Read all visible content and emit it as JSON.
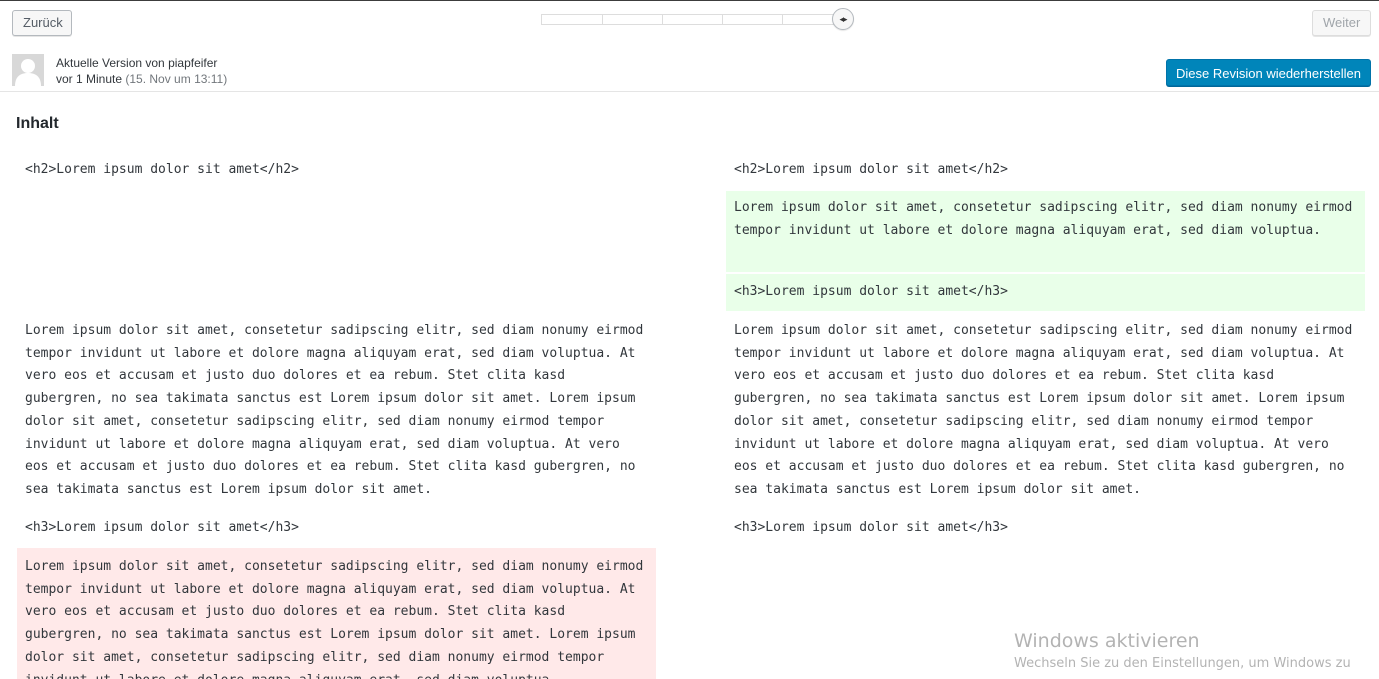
{
  "toolbar": {
    "back_label": "Zurück",
    "next_label": "Weiter",
    "slider_handle_glyph": "◂▸",
    "slider_position": 1.0
  },
  "revision": {
    "title": "Aktuelle Version von piapfeifer",
    "relative_time": "vor 1 Minute",
    "date": "(15. Nov um 13:11)",
    "restore_label": "Diese Revision wiederherstellen"
  },
  "section": {
    "title": "Inhalt"
  },
  "left": {
    "h2": "<h2>Lorem ipsum dolor sit amet</h2>",
    "para": "Lorem ipsum dolor sit amet, consetetur sadipscing elitr, sed diam nonumy eirmod tempor invidunt ut labore et dolore magna aliquyam erat, sed diam voluptua. At vero eos et accusam et justo duo dolores et ea rebum. Stet clita kasd gubergren, no sea takimata sanctus est Lorem ipsum dolor sit amet. Lorem ipsum dolor sit amet, consetetur sadipscing elitr, sed diam nonumy eirmod tempor invidunt ut labore et dolore magna aliquyam erat, sed diam voluptua. At vero eos et accusam et justo duo dolores et ea rebum. Stet clita kasd gubergren, no sea takimata sanctus est Lorem ipsum dolor sit amet.",
    "h3": "<h3>Lorem ipsum dolor sit amet</h3>",
    "removed_para": "Lorem ipsum dolor sit amet, consetetur sadipscing elitr, sed diam nonumy eirmod tempor invidunt ut labore et dolore magna aliquyam erat, sed diam voluptua. At vero eos et accusam et justo duo dolores et ea rebum. Stet clita kasd gubergren, no sea takimata sanctus est Lorem ipsum dolor sit amet. Lorem ipsum dolor sit amet, consetetur sadipscing elitr, sed diam nonumy eirmod tempor invidunt ut labore et dolore magna aliquyam erat, sed diam voluptua."
  },
  "right": {
    "h2": "<h2>Lorem ipsum dolor sit amet</h2>",
    "added_para": "Lorem ipsum dolor sit amet, consetetur sadipscing elitr, sed diam nonumy eirmod tempor invidunt ut labore et dolore magna aliquyam erat, sed diam voluptua.",
    "added_h3": "<h3>Lorem ipsum dolor sit amet</h3>",
    "para": "Lorem ipsum dolor sit amet, consetetur sadipscing elitr, sed diam nonumy eirmod tempor invidunt ut labore et dolore magna aliquyam erat, sed diam voluptua. At vero eos et accusam et justo duo dolores et ea rebum. Stet clita kasd gubergren, no sea takimata sanctus est Lorem ipsum dolor sit amet. Lorem ipsum dolor sit amet, consetetur sadipscing elitr, sed diam nonumy eirmod tempor invidunt ut labore et dolore magna aliquyam erat, sed diam voluptua. At vero eos et accusam et justo duo dolores et ea rebum. Stet clita kasd gubergren, no sea takimata sanctus est Lorem ipsum dolor sit amet.",
    "h3": "<h3>Lorem ipsum dolor sit amet</h3>"
  },
  "watermark": {
    "title": "Windows aktivieren",
    "subtitle": "Wechseln Sie zu den Einstellungen, um Windows zu"
  },
  "colors": {
    "primary_button": "#0085ba",
    "added_bg": "#e9ffe9",
    "removed_bg": "#ffe9e9"
  }
}
